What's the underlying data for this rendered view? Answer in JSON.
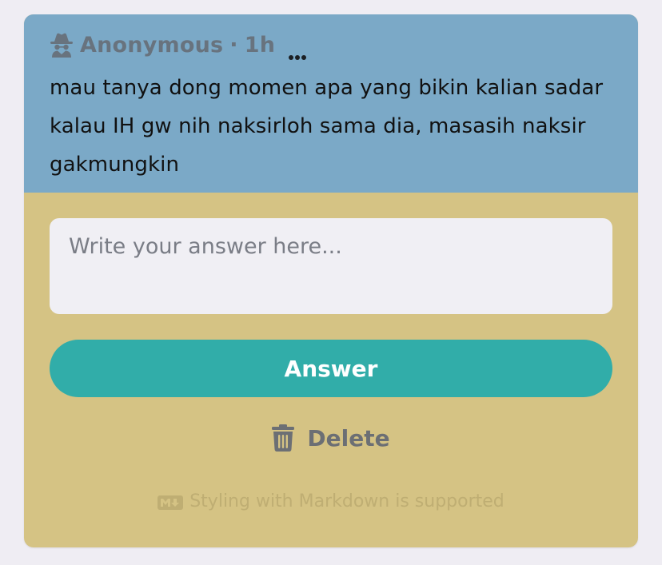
{
  "question": {
    "author": "Anonymous",
    "separator": "·",
    "time": "1h",
    "text": "mau tanya dong momen apa yang bikin kalian sadar kalau IH gw nih naksirloh sama dia, masasih naksir gakmungkin"
  },
  "answer_form": {
    "placeholder": "Write your answer here...",
    "value": "",
    "submit_label": "Answer",
    "delete_label": "Delete",
    "markdown_note": "Styling with Markdown is supported"
  },
  "colors": {
    "page_bg": "#efedf3",
    "question_bg": "#7ba9c7",
    "card_bg": "#d5c384",
    "button_bg": "#31ada9",
    "muted_text": "#68737e"
  },
  "icons": {
    "author": "spy-icon",
    "more": "more-horizontal-icon",
    "delete": "trash-icon",
    "markdown": "markdown-icon"
  }
}
